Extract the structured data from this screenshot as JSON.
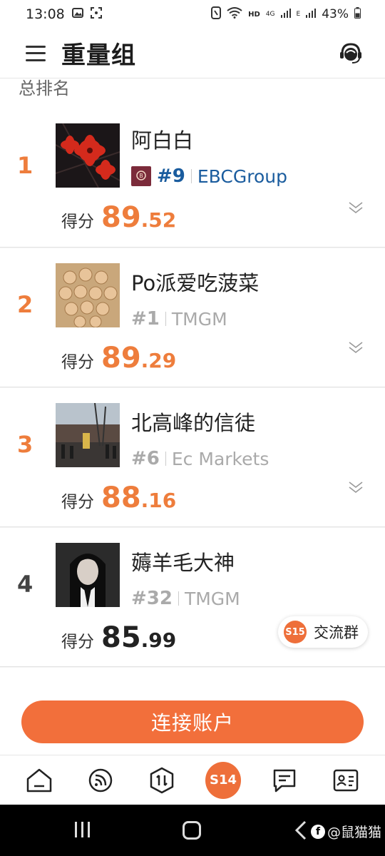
{
  "status_bar": {
    "time": "13:08",
    "network": "HD",
    "cell_4g": "4G",
    "cell_e": "E",
    "battery": "43%"
  },
  "header": {
    "title": "重量组"
  },
  "section": {
    "title": "总排名"
  },
  "leaderboard": [
    {
      "rank": "1",
      "name": "阿白白",
      "tag": "#9",
      "broker": "EBCGroup",
      "score_label": "得分",
      "score_int": "89",
      "score_dec": ".52",
      "broker_verified": true
    },
    {
      "rank": "2",
      "name": "Po派爱吃菠菜",
      "tag": "#1",
      "broker": "TMGM",
      "score_label": "得分",
      "score_int": "89",
      "score_dec": ".29",
      "broker_verified": false
    },
    {
      "rank": "3",
      "name": "北高峰的信徒",
      "tag": "#6",
      "broker": "Ec Markets",
      "score_label": "得分",
      "score_int": "88",
      "score_dec": ".16",
      "broker_verified": false
    },
    {
      "rank": "4",
      "name": "薅羊毛大神",
      "tag": "#32",
      "broker": "TMGM",
      "score_label": "得分",
      "score_int": "85",
      "score_dec": ".99",
      "broker_verified": false
    }
  ],
  "group_chip": {
    "logo": "S15",
    "label": "交流群"
  },
  "connect_button": {
    "label": "连接账户"
  },
  "tabbar": {
    "center_label": "S14",
    "tabs": [
      "home-icon",
      "feed-icon",
      "trade-icon",
      "s14-icon",
      "messages-icon",
      "profile-card-icon"
    ]
  },
  "watermark": {
    "text": "@鼠猫猫"
  },
  "colors": {
    "accent": "#ee7d3c",
    "button": "#f26f3b",
    "link_blue": "#1a5c9e"
  }
}
